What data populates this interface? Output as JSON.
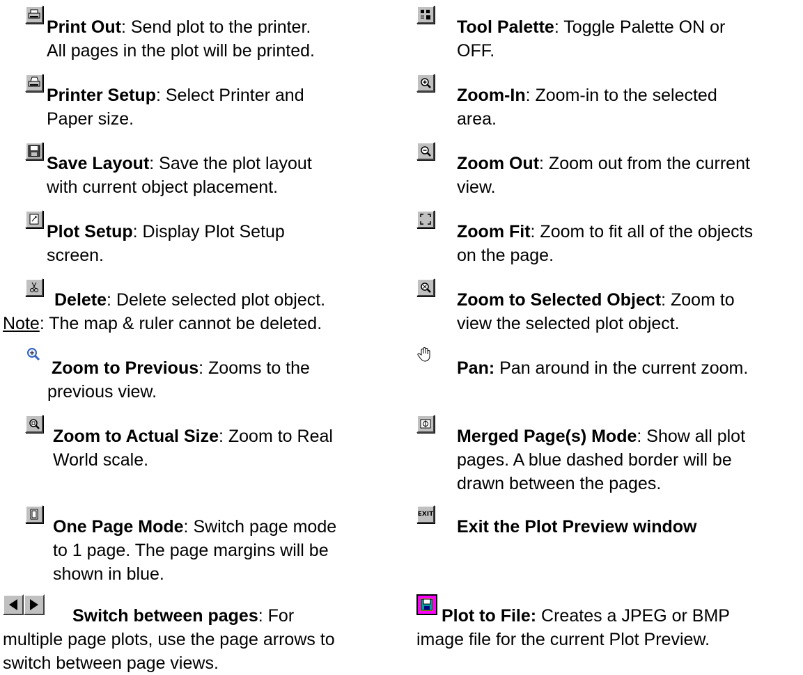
{
  "left": [
    {
      "icon": "printer-icon",
      "title": "Print Out",
      "sep": ":",
      "desc": " Send plot to the printer.",
      "line2": "All pages in the plot will be printed."
    },
    {
      "icon": "printer-setup-icon",
      "title": "Printer Setup",
      "sep": ":",
      "desc": " Select Printer and",
      "line2": "Paper size."
    },
    {
      "icon": "floppy-disk-icon",
      "title": "Save Layout",
      "sep": ":",
      "desc": " Save the plot layout",
      "line2": "with current object placement."
    },
    {
      "icon": "plot-setup-icon",
      "title": "Plot Setup",
      "sep": ":",
      "desc": " Display Plot Setup",
      "line2": "screen."
    },
    {
      "icon": "scissors-icon",
      "title": "Delete",
      "sep": ":",
      "desc": " Delete selected plot object.",
      "note_label": "Note",
      "note_text": ": The map & ruler cannot be deleted."
    },
    {
      "icon": "zoom-previous-icon",
      "title": "Zoom to Previous",
      "sep": ":",
      "desc": "  Zooms to the",
      "line2": "previous view."
    },
    {
      "icon": "zoom-actual-size-icon",
      "title": "Zoom to Actual Size",
      "sep": ":",
      "desc": "  Zoom to Real",
      "line2": "World scale."
    },
    {
      "icon": "one-page-mode-icon",
      "title": "One Page Mode",
      "sep": ":",
      "desc": " Switch page mode",
      "line2": "to 1 page. The page margins will be",
      "line3": "shown in blue."
    },
    {
      "icon": "page-arrows-icon",
      "title": "Switch between pages",
      "sep": ":",
      "desc": " For",
      "line2": "multiple page plots, use the page arrows to",
      "line3": "switch between page views."
    }
  ],
  "right": [
    {
      "icon": "tool-palette-icon",
      "title": "Tool Palette",
      "sep": ":",
      "desc": " Toggle Palette ON or",
      "line2": "OFF."
    },
    {
      "icon": "zoom-in-icon",
      "title": "Zoom-In",
      "sep": ":",
      "desc": " Zoom-in to the selected",
      "line2": "area."
    },
    {
      "icon": "zoom-out-icon",
      "title": "Zoom Out",
      "sep": ":",
      "desc": " Zoom out from the current",
      "line2": "view."
    },
    {
      "icon": "zoom-fit-icon",
      "title": "Zoom Fit",
      "sep": ":",
      "desc": " Zoom to fit all of the objects",
      "line2": "on the page."
    },
    {
      "icon": "zoom-selected-object-icon",
      "title": "Zoom to Selected Object",
      "sep": ":",
      "desc": " Zoom to",
      "line2": "view the selected plot object."
    },
    {
      "icon": "pan-hand-icon",
      "title": "Pan:",
      "sep": "",
      "desc": "  Pan around in the current zoom."
    },
    {
      "icon": "merged-pages-icon",
      "title": "Merged Page(s) Mode",
      "sep": ":",
      "desc": " Show all plot",
      "line2": "pages.  A blue dashed border will be",
      "line3": "drawn between the pages."
    },
    {
      "icon": "exit-icon",
      "icon_label": "EXIT",
      "title": "Exit the Plot Preview window"
    },
    {
      "icon": "plot-to-file-icon",
      "title": "Plot to File:",
      "sep": "",
      "desc": " Creates a JPEG or BMP",
      "line2": "image file for the current Plot Preview."
    }
  ]
}
